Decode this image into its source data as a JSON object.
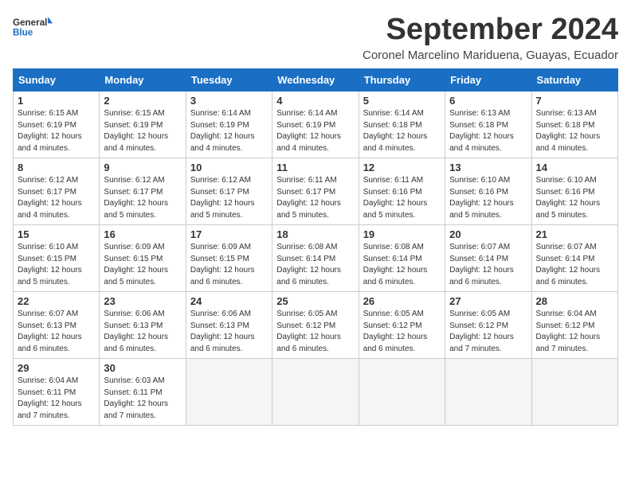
{
  "logo": {
    "general": "General",
    "blue": "Blue"
  },
  "title": "September 2024",
  "subtitle": "Coronel Marcelino Mariduena, Guayas, Ecuador",
  "days_of_week": [
    "Sunday",
    "Monday",
    "Tuesday",
    "Wednesday",
    "Thursday",
    "Friday",
    "Saturday"
  ],
  "weeks": [
    [
      {
        "day": 1,
        "sunrise": "6:15 AM",
        "sunset": "6:19 PM",
        "daylight": "12 hours and 4 minutes."
      },
      {
        "day": 2,
        "sunrise": "6:15 AM",
        "sunset": "6:19 PM",
        "daylight": "12 hours and 4 minutes."
      },
      {
        "day": 3,
        "sunrise": "6:14 AM",
        "sunset": "6:19 PM",
        "daylight": "12 hours and 4 minutes."
      },
      {
        "day": 4,
        "sunrise": "6:14 AM",
        "sunset": "6:19 PM",
        "daylight": "12 hours and 4 minutes."
      },
      {
        "day": 5,
        "sunrise": "6:14 AM",
        "sunset": "6:18 PM",
        "daylight": "12 hours and 4 minutes."
      },
      {
        "day": 6,
        "sunrise": "6:13 AM",
        "sunset": "6:18 PM",
        "daylight": "12 hours and 4 minutes."
      },
      {
        "day": 7,
        "sunrise": "6:13 AM",
        "sunset": "6:18 PM",
        "daylight": "12 hours and 4 minutes."
      }
    ],
    [
      {
        "day": 8,
        "sunrise": "6:12 AM",
        "sunset": "6:17 PM",
        "daylight": "12 hours and 4 minutes."
      },
      {
        "day": 9,
        "sunrise": "6:12 AM",
        "sunset": "6:17 PM",
        "daylight": "12 hours and 5 minutes."
      },
      {
        "day": 10,
        "sunrise": "6:12 AM",
        "sunset": "6:17 PM",
        "daylight": "12 hours and 5 minutes."
      },
      {
        "day": 11,
        "sunrise": "6:11 AM",
        "sunset": "6:17 PM",
        "daylight": "12 hours and 5 minutes."
      },
      {
        "day": 12,
        "sunrise": "6:11 AM",
        "sunset": "6:16 PM",
        "daylight": "12 hours and 5 minutes."
      },
      {
        "day": 13,
        "sunrise": "6:10 AM",
        "sunset": "6:16 PM",
        "daylight": "12 hours and 5 minutes."
      },
      {
        "day": 14,
        "sunrise": "6:10 AM",
        "sunset": "6:16 PM",
        "daylight": "12 hours and 5 minutes."
      }
    ],
    [
      {
        "day": 15,
        "sunrise": "6:10 AM",
        "sunset": "6:15 PM",
        "daylight": "12 hours and 5 minutes."
      },
      {
        "day": 16,
        "sunrise": "6:09 AM",
        "sunset": "6:15 PM",
        "daylight": "12 hours and 5 minutes."
      },
      {
        "day": 17,
        "sunrise": "6:09 AM",
        "sunset": "6:15 PM",
        "daylight": "12 hours and 6 minutes."
      },
      {
        "day": 18,
        "sunrise": "6:08 AM",
        "sunset": "6:14 PM",
        "daylight": "12 hours and 6 minutes."
      },
      {
        "day": 19,
        "sunrise": "6:08 AM",
        "sunset": "6:14 PM",
        "daylight": "12 hours and 6 minutes."
      },
      {
        "day": 20,
        "sunrise": "6:07 AM",
        "sunset": "6:14 PM",
        "daylight": "12 hours and 6 minutes."
      },
      {
        "day": 21,
        "sunrise": "6:07 AM",
        "sunset": "6:14 PM",
        "daylight": "12 hours and 6 minutes."
      }
    ],
    [
      {
        "day": 22,
        "sunrise": "6:07 AM",
        "sunset": "6:13 PM",
        "daylight": "12 hours and 6 minutes."
      },
      {
        "day": 23,
        "sunrise": "6:06 AM",
        "sunset": "6:13 PM",
        "daylight": "12 hours and 6 minutes."
      },
      {
        "day": 24,
        "sunrise": "6:06 AM",
        "sunset": "6:13 PM",
        "daylight": "12 hours and 6 minutes."
      },
      {
        "day": 25,
        "sunrise": "6:05 AM",
        "sunset": "6:12 PM",
        "daylight": "12 hours and 6 minutes."
      },
      {
        "day": 26,
        "sunrise": "6:05 AM",
        "sunset": "6:12 PM",
        "daylight": "12 hours and 6 minutes."
      },
      {
        "day": 27,
        "sunrise": "6:05 AM",
        "sunset": "6:12 PM",
        "daylight": "12 hours and 7 minutes."
      },
      {
        "day": 28,
        "sunrise": "6:04 AM",
        "sunset": "6:12 PM",
        "daylight": "12 hours and 7 minutes."
      }
    ],
    [
      {
        "day": 29,
        "sunrise": "6:04 AM",
        "sunset": "6:11 PM",
        "daylight": "12 hours and 7 minutes."
      },
      {
        "day": 30,
        "sunrise": "6:03 AM",
        "sunset": "6:11 PM",
        "daylight": "12 hours and 7 minutes."
      },
      null,
      null,
      null,
      null,
      null
    ]
  ]
}
